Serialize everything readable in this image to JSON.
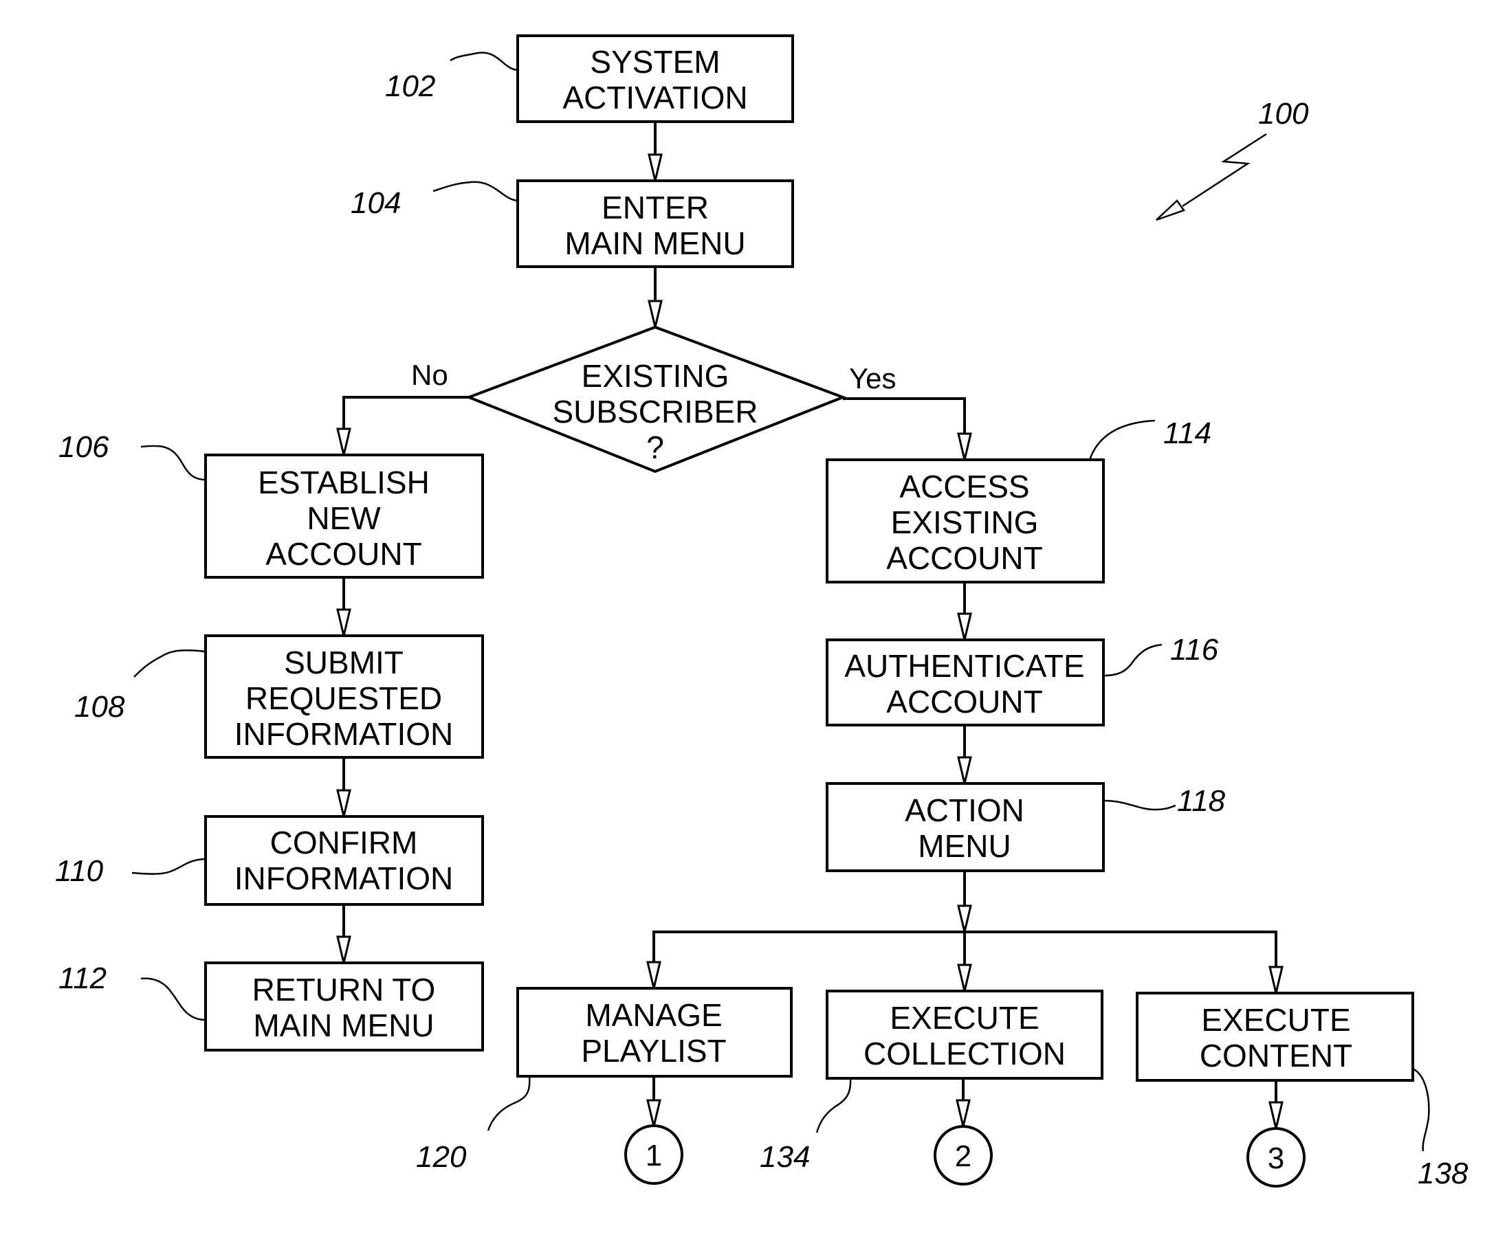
{
  "figure": {
    "reference": "100",
    "nodes": {
      "n102": {
        "ref": "102",
        "lines": [
          "SYSTEM",
          "ACTIVATION"
        ]
      },
      "n104": {
        "ref": "104",
        "lines": [
          "ENTER",
          "MAIN  MENU"
        ]
      },
      "decision": {
        "lines": [
          "EXISTING",
          "SUBSCRIBER",
          "?"
        ],
        "no_label": "No",
        "yes_label": "Yes"
      },
      "n106": {
        "ref": "106",
        "lines": [
          "ESTABLISH",
          "NEW",
          "ACCOUNT"
        ]
      },
      "n108": {
        "ref": "108",
        "lines": [
          "SUBMIT",
          "REQUESTED",
          "INFORMATION"
        ]
      },
      "n110": {
        "ref": "110",
        "lines": [
          "CONFIRM",
          "INFORMATION"
        ]
      },
      "n112": {
        "ref": "112",
        "lines": [
          "RETURN  TO",
          "MAIN  MENU"
        ]
      },
      "n114": {
        "ref": "114",
        "lines": [
          "ACCESS",
          "EXISTING",
          "ACCOUNT"
        ]
      },
      "n116": {
        "ref": "116",
        "lines": [
          "AUTHENTICATE",
          "ACCOUNT"
        ]
      },
      "n118": {
        "ref": "118",
        "lines": [
          "ACTION",
          "MENU"
        ]
      },
      "n120": {
        "ref": "120",
        "lines": [
          "MANAGE",
          "PLAYLIST"
        ]
      },
      "n134": {
        "ref": "134",
        "lines": [
          "EXECUTE",
          "COLLECTION"
        ]
      },
      "n138": {
        "ref": "138",
        "lines": [
          "EXECUTE",
          "CONTENT"
        ]
      }
    },
    "connectors": [
      "1",
      "2",
      "3"
    ]
  }
}
